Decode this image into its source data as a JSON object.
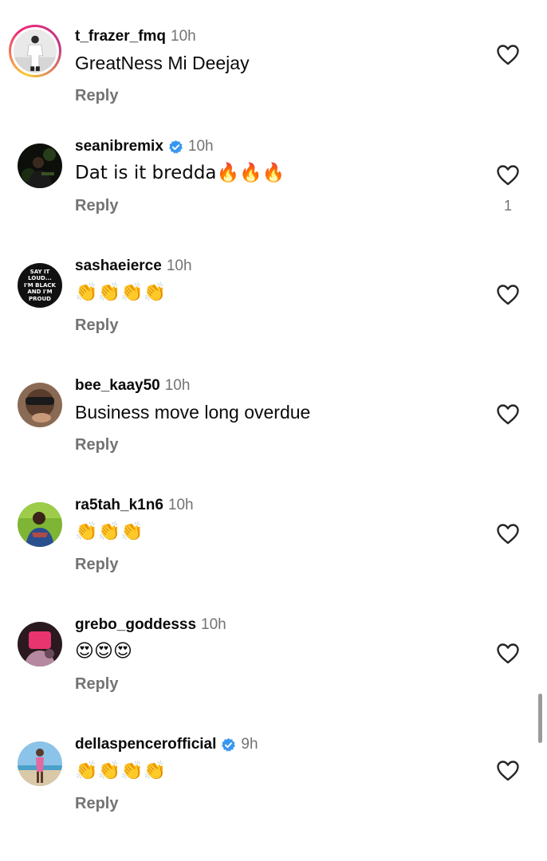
{
  "comments": [
    {
      "username": "t_frazer_fmq",
      "time": "10h",
      "text": "GreatNess Mi Deejay",
      "reply": "Reply",
      "likes": "",
      "verified": false
    },
    {
      "username": "seanibremix",
      "time": "10h",
      "text": "Dat is it bredda🔥🔥🔥",
      "reply": "Reply",
      "likes": "1",
      "verified": true
    },
    {
      "username": "sashaeierce",
      "time": "10h",
      "text": "👏👏👏👏",
      "reply": "Reply",
      "likes": "",
      "verified": false
    },
    {
      "username": "bee_kaay50",
      "time": "10h",
      "text": "Business move long overdue",
      "reply": "Reply",
      "likes": "",
      "verified": false
    },
    {
      "username": "ra5tah_k1n6",
      "time": "10h",
      "text": "👏👏👏",
      "reply": "Reply",
      "likes": "",
      "verified": false
    },
    {
      "username": "grebo_goddesss",
      "time": "10h",
      "text": "😍😍😍",
      "reply": "Reply",
      "likes": "",
      "verified": false
    },
    {
      "username": "dellaspencerofficial",
      "time": "9h",
      "text": "👏👏👏👏",
      "reply": "Reply",
      "likes": "",
      "verified": true
    }
  ],
  "avatar_badge_text": [
    "SAY IT",
    "LOUD...",
    "I'M BLACK",
    "AND I'M",
    "PROUD"
  ],
  "colors": {
    "username": "#0a0a0a",
    "meta": "#737373",
    "verified": "#3897f0",
    "background": "#ffffff"
  },
  "icons": {
    "like": "heart-outline-icon",
    "verified": "verified-badge-icon"
  }
}
